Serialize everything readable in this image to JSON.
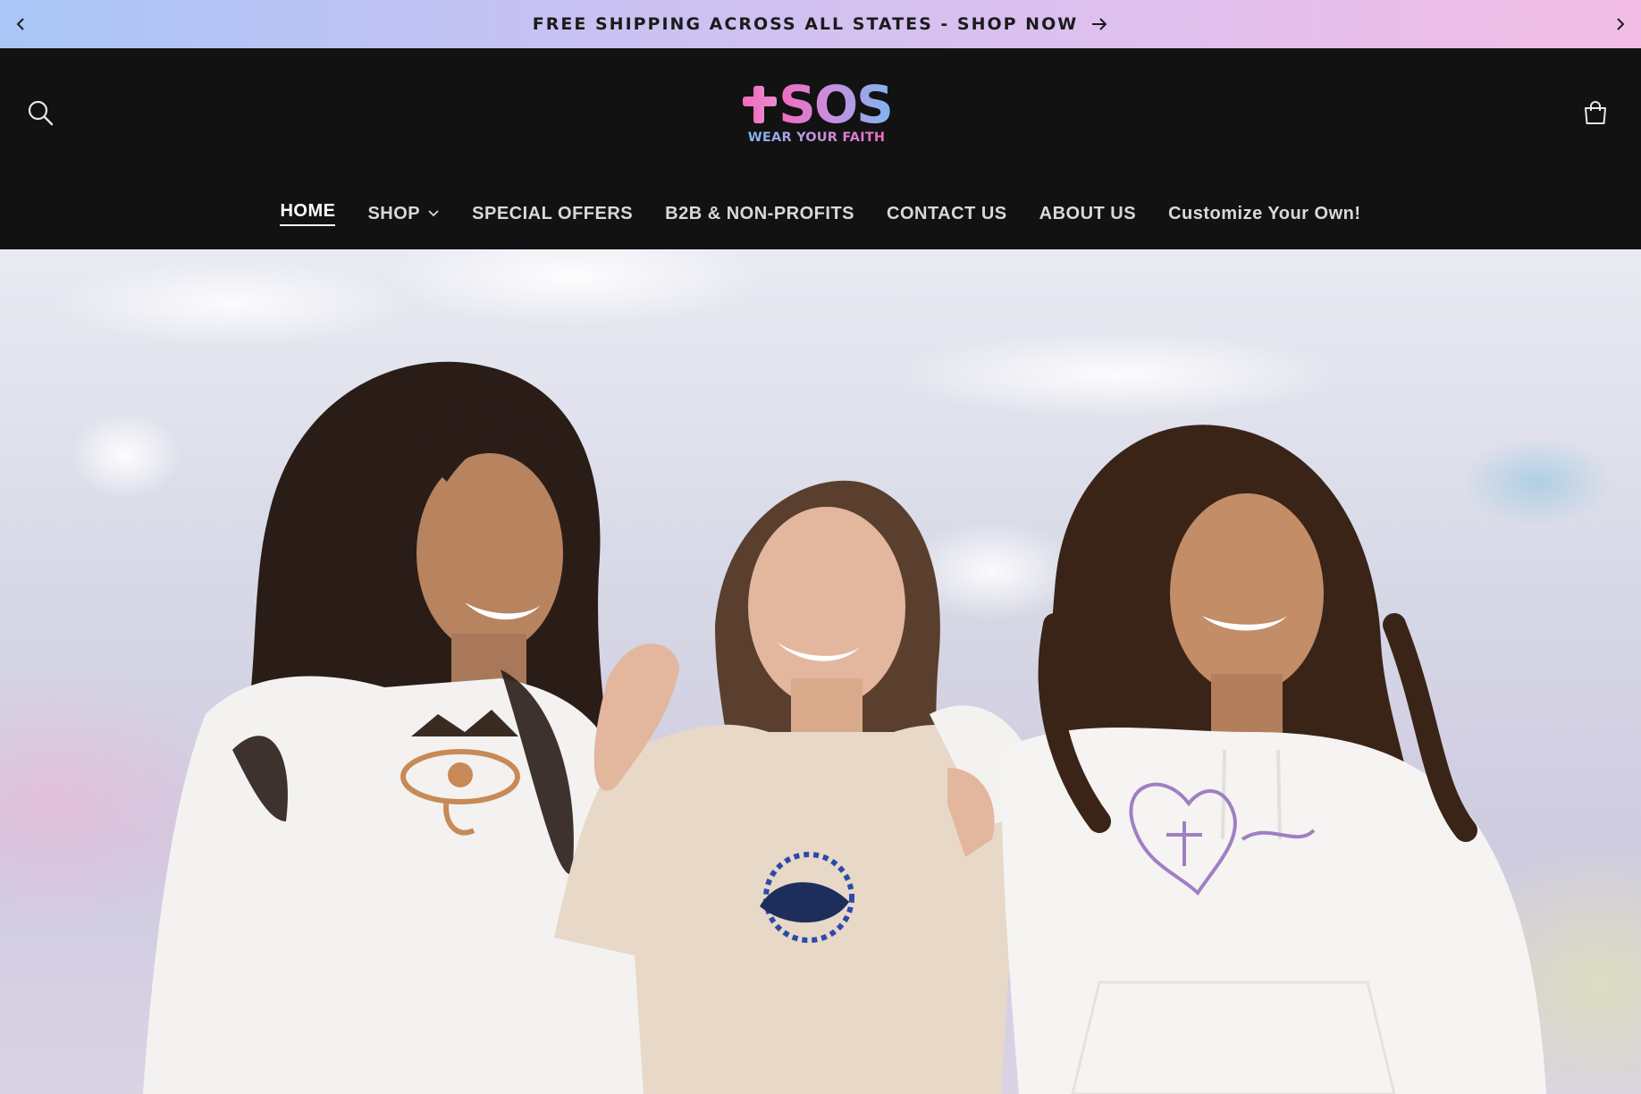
{
  "announcement": {
    "text": "FREE SHIPPING ACROSS ALL STATES - SHOP NOW",
    "prev_icon": "chevron-left-icon",
    "next_icon": "chevron-right-icon",
    "arrow_icon": "arrow-right-icon"
  },
  "header": {
    "logo_text": "SOS",
    "logo_tagline": "WEAR YOUR FAITH",
    "search_icon": "search-icon",
    "cart_icon": "cart-icon"
  },
  "nav": {
    "items": [
      {
        "label": "HOME",
        "active": true
      },
      {
        "label": "SHOP",
        "has_dropdown": true
      },
      {
        "label": "SPECIAL OFFERS"
      },
      {
        "label": "B2B & NON-PROFITS"
      },
      {
        "label": "CONTACT US"
      },
      {
        "label": "ABOUT US"
      },
      {
        "label": "Customize Your Own!"
      }
    ]
  },
  "hero": {
    "image": "three-women-wearing-embroidered-faith-apparel"
  },
  "colors": {
    "header_bg": "#121212",
    "nav_text": "#d9d9d9",
    "logo_pink": "#f06bbd",
    "logo_blue": "#7fb6f0"
  }
}
